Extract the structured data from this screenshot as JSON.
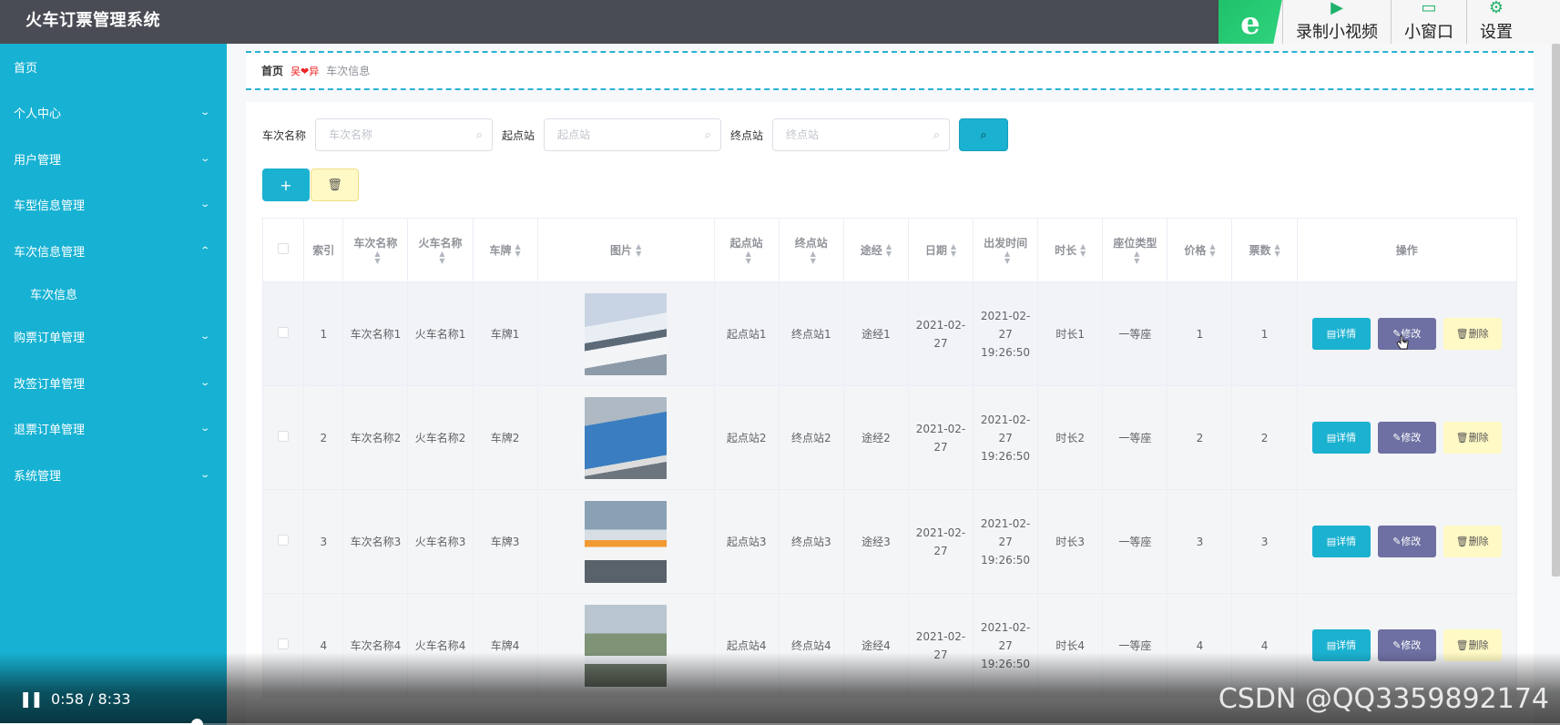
{
  "app": {
    "title": "火车订票管理系统"
  },
  "toolbar": {
    "logo": "e",
    "items": [
      {
        "label": "录制小视频",
        "icon": "video-icon"
      },
      {
        "label": "小窗口",
        "icon": "window-icon"
      },
      {
        "label": "设置",
        "icon": "gear-icon"
      }
    ]
  },
  "sidebar": {
    "items": [
      {
        "label": "首页",
        "arrow": ""
      },
      {
        "label": "个人中心",
        "arrow": "down"
      },
      {
        "label": "用户管理",
        "arrow": "down"
      },
      {
        "label": "车型信息管理",
        "arrow": "down"
      },
      {
        "label": "车次信息管理",
        "arrow": "up"
      },
      {
        "label": "车次信息",
        "arrow": ""
      },
      {
        "label": "购票订单管理",
        "arrow": "down"
      },
      {
        "label": "改签订单管理",
        "arrow": "down"
      },
      {
        "label": "退票订单管理",
        "arrow": "down"
      },
      {
        "label": "系统管理",
        "arrow": "down"
      }
    ]
  },
  "breadcrumb": {
    "home": "首页",
    "separator": "吴❤异",
    "current": "车次信息"
  },
  "search": {
    "train_label": "车次名称",
    "train_placeholder": "车次名称",
    "start_label": "起点站",
    "start_placeholder": "起点站",
    "end_label": "终点站",
    "end_placeholder": "终点站"
  },
  "table": {
    "headers": {
      "index": "索引",
      "train_name": "车次名称",
      "locomotive": "火车名称",
      "plate": "车牌",
      "picture": "图片",
      "start": "起点站",
      "end": "终点站",
      "via": "途经",
      "date": "日期",
      "depart": "出发时间",
      "duration": "时长",
      "seat": "座位类型",
      "price": "价格",
      "tickets": "票数",
      "actions": "操作"
    },
    "rows": [
      {
        "index": "1",
        "train_name": "车次名称1",
        "locomotive": "火车名称1",
        "plate": "车牌1",
        "start": "起点站1",
        "end": "终点站1",
        "via": "途经1",
        "date": "2021-02-27",
        "depart": "2021-02-27 19:26:50",
        "duration": "时长1",
        "seat": "一等座",
        "price": "1",
        "tickets": "1"
      },
      {
        "index": "2",
        "train_name": "车次名称2",
        "locomotive": "火车名称2",
        "plate": "车牌2",
        "start": "起点站2",
        "end": "终点站2",
        "via": "途经2",
        "date": "2021-02-27",
        "depart": "2021-02-27 19:26:50",
        "duration": "时长2",
        "seat": "一等座",
        "price": "2",
        "tickets": "2"
      },
      {
        "index": "3",
        "train_name": "车次名称3",
        "locomotive": "火车名称3",
        "plate": "车牌3",
        "start": "起点站3",
        "end": "终点站3",
        "via": "途经3",
        "date": "2021-02-27",
        "depart": "2021-02-27 19:26:50",
        "duration": "时长3",
        "seat": "一等座",
        "price": "3",
        "tickets": "3"
      },
      {
        "index": "4",
        "train_name": "车次名称4",
        "locomotive": "火车名称4",
        "plate": "车牌4",
        "start": "起点站4",
        "end": "终点站4",
        "via": "途经4",
        "date": "2021-02-27",
        "depart": "2021-02-27 19:26:50",
        "duration": "时长4",
        "seat": "一等座",
        "price": "4",
        "tickets": "4"
      }
    ],
    "actions": {
      "detail": "详情",
      "edit": "修改",
      "delete": "删除"
    }
  },
  "video": {
    "time": "0:58 / 8:33",
    "progress": 0.113,
    "watermark": "CSDN @QQ3359892174"
  },
  "colors": {
    "sidebar": "#17b2d3",
    "topbar": "#4a4c55",
    "primary": "#1bb1d0",
    "edit": "#6e6fa2",
    "delete_bg": "#fff9c5"
  }
}
